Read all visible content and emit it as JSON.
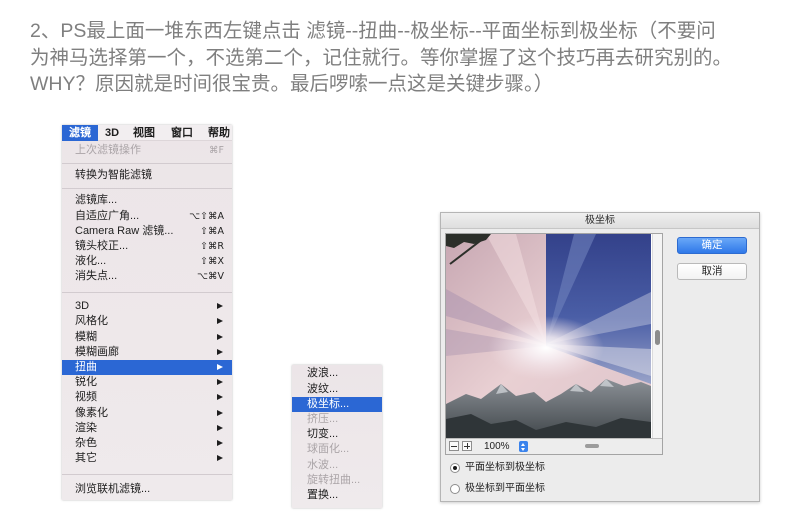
{
  "instruction": {
    "lines": [
      "2、PS最上面一堆东西左键点击 滤镜--扭曲--极坐标--平面坐标到极坐标（不要问",
      "为神马选择第一个，不选第二个，记住就行。等你掌握了这个技巧再去研究别的。",
      "WHY？原因就是时间很宝贵。最后啰嗦一点这是关键步骤。）"
    ]
  },
  "filter_menu": {
    "menubar": [
      {
        "label": "滤镜",
        "active": true
      },
      {
        "label": "3D",
        "active": false
      },
      {
        "label": "视图",
        "active": false
      },
      {
        "label": "窗口",
        "active": false
      },
      {
        "label": "帮助",
        "active": false
      }
    ],
    "items": [
      {
        "label": "上次滤镜操作",
        "shortcut": "⌘F",
        "disabled": true
      },
      {
        "label": "转换为智能滤镜"
      },
      {
        "label": "滤镜库..."
      },
      {
        "label": "自适应广角...",
        "shortcut": "⌥⇧⌘A"
      },
      {
        "label": "Camera Raw 滤镜...",
        "shortcut": "⇧⌘A"
      },
      {
        "label": "镜头校正...",
        "shortcut": "⇧⌘R"
      },
      {
        "label": "液化...",
        "shortcut": "⇧⌘X"
      },
      {
        "label": "消失点...",
        "shortcut": "⌥⌘V"
      },
      {
        "label": "3D",
        "submenu": true
      },
      {
        "label": "风格化",
        "submenu": true
      },
      {
        "label": "模糊",
        "submenu": true
      },
      {
        "label": "模糊画廊",
        "submenu": true
      },
      {
        "label": "扭曲",
        "submenu": true,
        "highlighted": true
      },
      {
        "label": "锐化",
        "submenu": true
      },
      {
        "label": "视频",
        "submenu": true
      },
      {
        "label": "像素化",
        "submenu": true
      },
      {
        "label": "渲染",
        "submenu": true
      },
      {
        "label": "杂色",
        "submenu": true
      },
      {
        "label": "其它",
        "submenu": true
      },
      {
        "label": "浏览联机滤镜..."
      }
    ],
    "submenu_icon": "submenu-arrow-icon"
  },
  "distort_submenu": {
    "items": [
      {
        "label": "波浪..."
      },
      {
        "label": "波纹..."
      },
      {
        "label": "极坐标...",
        "highlighted": true
      },
      {
        "label": "挤压...",
        "disabled": true
      },
      {
        "label": "切变..."
      },
      {
        "label": "球面化...",
        "disabled": true
      },
      {
        "label": "水波...",
        "disabled": true
      },
      {
        "label": "旋转扭曲...",
        "disabled": true
      },
      {
        "label": "置换..."
      }
    ]
  },
  "dialog": {
    "title": "极坐标",
    "ok_label": "确定",
    "cancel_label": "取消",
    "zoom_level": "100%",
    "zoom_out_icon": "minus-icon",
    "zoom_in_icon": "plus-icon",
    "zoom_menu_icon": "up-down-chevron-icon",
    "options": [
      {
        "label": "平面坐标到极坐标",
        "selected": true
      },
      {
        "label": "极坐标到平面坐标",
        "selected": false
      }
    ]
  },
  "colors": {
    "menu_highlight": "#2b67d4",
    "button_primary": "#3a83ec",
    "instruction_text": "#7f7f7f",
    "disabled_text": "#aaa4a7"
  }
}
